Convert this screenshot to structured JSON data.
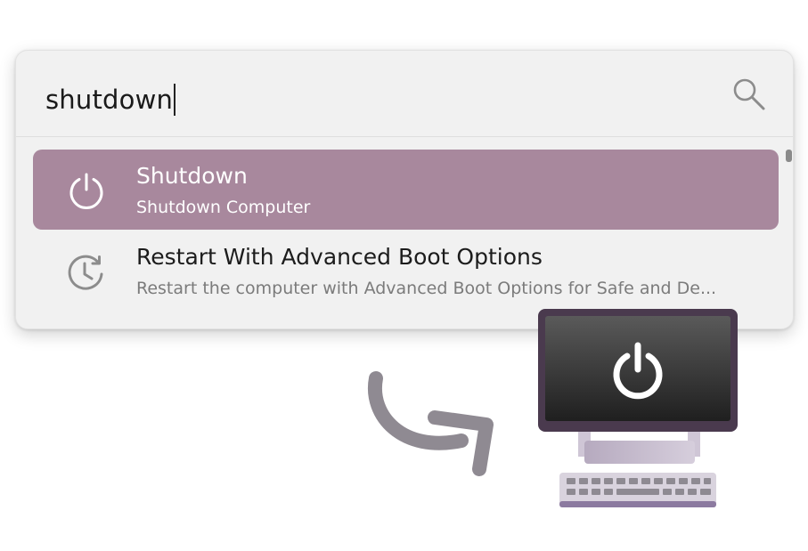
{
  "search": {
    "query": "shutdown",
    "icon": "search-icon"
  },
  "results": [
    {
      "title": "Shutdown",
      "subtitle": "Shutdown Computer",
      "icon": "power-icon",
      "selected": true
    },
    {
      "title": "Restart With Advanced Boot Options",
      "subtitle": "Restart the computer with Advanced Boot Options for Safe and De...",
      "icon": "restart-clock-icon",
      "selected": false
    }
  ],
  "colors": {
    "selected_row": "#a8889d",
    "window_bg": "#f1f1f1",
    "accent_purple": "#4a3a4e"
  },
  "illustration": {
    "arrow": "curved-arrow-icon",
    "computer": "computer-power-icon"
  }
}
